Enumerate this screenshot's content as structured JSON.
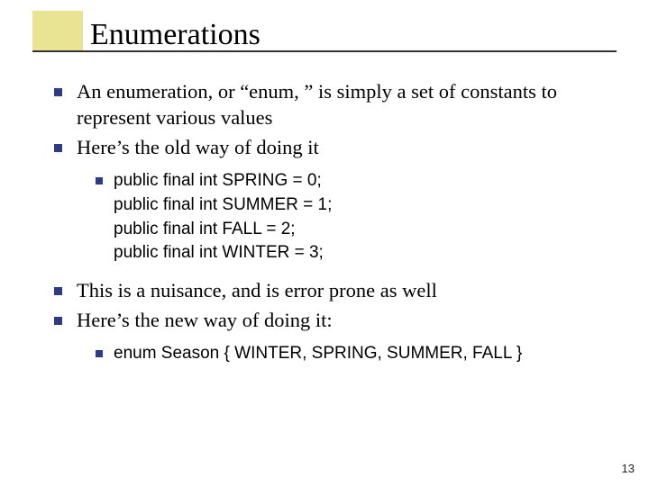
{
  "title": "Enumerations",
  "bullets": {
    "b0": "An enumeration, or “enum, ” is simply a set of constants to represent various values",
    "b1": "Here’s the old way of doing it",
    "b2": "This is a nuisance, and is error prone as well",
    "b3": "Here’s the new way of doing it:"
  },
  "code": {
    "old0": "public final int SPRING = 0;",
    "old1": "public final int SUMMER = 1;",
    "old2": "public final int FALL = 2;",
    "old3": "public final int WINTER = 3;",
    "new0": "enum Season { WINTER, SPRING, SUMMER, FALL }"
  },
  "page": "13"
}
